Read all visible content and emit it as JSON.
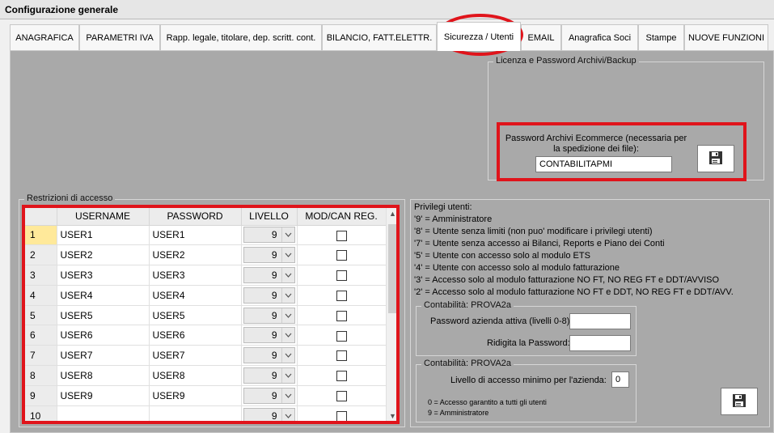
{
  "window": {
    "title": "Configurazione generale"
  },
  "tabs": [
    {
      "label": "ANAGRAFICA"
    },
    {
      "label": "PARAMETRI IVA"
    },
    {
      "label": "Rapp. legale, titolare, dep. scritt. cont."
    },
    {
      "label": "BILANCIO, FATT.ELETTR."
    },
    {
      "label": "Sicurezza / Utenti",
      "active": true
    },
    {
      "label": "EMAIL"
    },
    {
      "label": "Anagrafica Soci"
    },
    {
      "label": "Stampe"
    },
    {
      "label": "NUOVE FUNZIONI"
    }
  ],
  "license": {
    "group_title": "Licenza e Password Archivi/Backup",
    "ecommerce_label": "Password Archivi Ecommerce (necessaria per la spedizione dei file):",
    "ecommerce_value": "CONTABILITAPMI",
    "save_icon": "floppy-disk-icon"
  },
  "restrictions": {
    "group_title": "Restrizioni di accesso",
    "columns": [
      "USERNAME",
      "PASSWORD",
      "LIVELLO",
      "MOD/CAN REG."
    ],
    "rows": [
      {
        "num": "1",
        "username": "USER1",
        "password": "USER1",
        "level": "9",
        "checked": false
      },
      {
        "num": "2",
        "username": "USER2",
        "password": "USER2",
        "level": "9",
        "checked": false
      },
      {
        "num": "3",
        "username": "USER3",
        "password": "USER3",
        "level": "9",
        "checked": false
      },
      {
        "num": "4",
        "username": "USER4",
        "password": "USER4",
        "level": "9",
        "checked": false
      },
      {
        "num": "5",
        "username": "USER5",
        "password": "USER5",
        "level": "9",
        "checked": false
      },
      {
        "num": "6",
        "username": "USER6",
        "password": "USER6",
        "level": "9",
        "checked": false
      },
      {
        "num": "7",
        "username": "USER7",
        "password": "USER7",
        "level": "9",
        "checked": false
      },
      {
        "num": "8",
        "username": "USER8",
        "password": "USER8",
        "level": "9",
        "checked": false
      },
      {
        "num": "9",
        "username": "USER9",
        "password": "USER9",
        "level": "9",
        "checked": false
      },
      {
        "num": "10",
        "username": "",
        "password": "",
        "level": "9",
        "checked": false
      }
    ]
  },
  "privileges": {
    "title": "Privilegi utenti:",
    "lines": [
      "'9' = Amministratore",
      "'8' = Utente senza limiti (non puo' modificare i privilegi utenti)",
      "'7' = Utente senza accesso ai Bilanci,  Reports e Piano dei Conti",
      "'5' = Utente con accesso solo al modulo ETS",
      "'4' = Utente con accesso solo al modulo fatturazione",
      "'3' = Accesso solo al modulo fatturazione NO FT, NO REG FT e DDT/AVVISO",
      "'2' = Accesso solo al modulo fatturazione NO FT e DDT, NO REG FT e DDT/AVV."
    ]
  },
  "company_password": {
    "group_title": "Contabilità:  PROVA2a",
    "password_label": "Password azienda attiva (livelli 0-8):",
    "password_value": "",
    "confirm_label": "Ridigita la Password:",
    "confirm_value": ""
  },
  "company_level": {
    "group_title": "Contabilità:  PROVA2a",
    "level_label": "Livello di accesso minimo per l'azienda:",
    "level_value": "0",
    "note_1": "0 = Accesso garantito a tutti gli utenti",
    "note_2": "9 = Amministratore",
    "save_icon": "floppy-disk-icon"
  }
}
